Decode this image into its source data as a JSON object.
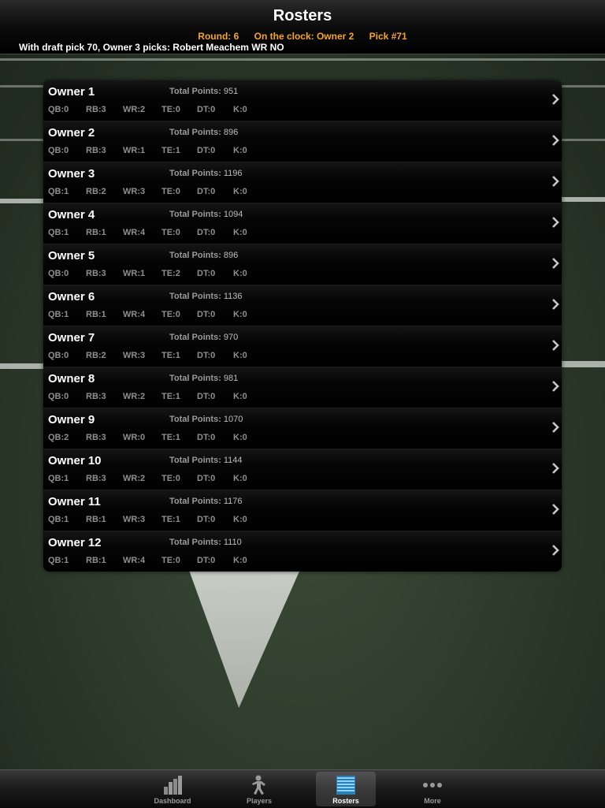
{
  "header": {
    "title": "Rosters",
    "round": "Round: 6",
    "on_clock": "On the clock: Owner 2",
    "pick": "Pick #71",
    "ticker": "With draft pick 70, Owner 3 picks: Robert Meachem WR NO"
  },
  "points_label": "Total Points:",
  "rosters": [
    {
      "owner": "Owner 1",
      "points": "951",
      "qb": "QB:0",
      "rb": "RB:3",
      "wr": "WR:2",
      "te": "TE:0",
      "dt": "DT:0",
      "k": "K:0"
    },
    {
      "owner": "Owner 2",
      "points": "896",
      "qb": "QB:0",
      "rb": "RB:3",
      "wr": "WR:1",
      "te": "TE:1",
      "dt": "DT:0",
      "k": "K:0"
    },
    {
      "owner": "Owner 3",
      "points": "1196",
      "qb": "QB:1",
      "rb": "RB:2",
      "wr": "WR:3",
      "te": "TE:0",
      "dt": "DT:0",
      "k": "K:0"
    },
    {
      "owner": "Owner 4",
      "points": "1094",
      "qb": "QB:1",
      "rb": "RB:1",
      "wr": "WR:4",
      "te": "TE:0",
      "dt": "DT:0",
      "k": "K:0"
    },
    {
      "owner": "Owner 5",
      "points": "896",
      "qb": "QB:0",
      "rb": "RB:3",
      "wr": "WR:1",
      "te": "TE:2",
      "dt": "DT:0",
      "k": "K:0"
    },
    {
      "owner": "Owner 6",
      "points": "1136",
      "qb": "QB:1",
      "rb": "RB:1",
      "wr": "WR:4",
      "te": "TE:0",
      "dt": "DT:0",
      "k": "K:0"
    },
    {
      "owner": "Owner 7",
      "points": "970",
      "qb": "QB:0",
      "rb": "RB:2",
      "wr": "WR:3",
      "te": "TE:1",
      "dt": "DT:0",
      "k": "K:0"
    },
    {
      "owner": "Owner 8",
      "points": "981",
      "qb": "QB:0",
      "rb": "RB:3",
      "wr": "WR:2",
      "te": "TE:1",
      "dt": "DT:0",
      "k": "K:0"
    },
    {
      "owner": "Owner 9",
      "points": "1070",
      "qb": "QB:2",
      "rb": "RB:3",
      "wr": "WR:0",
      "te": "TE:1",
      "dt": "DT:0",
      "k": "K:0"
    },
    {
      "owner": "Owner 10",
      "points": "1144",
      "qb": "QB:1",
      "rb": "RB:3",
      "wr": "WR:2",
      "te": "TE:0",
      "dt": "DT:0",
      "k": "K:0"
    },
    {
      "owner": "Owner 11",
      "points": "1176",
      "qb": "QB:1",
      "rb": "RB:1",
      "wr": "WR:3",
      "te": "TE:1",
      "dt": "DT:0",
      "k": "K:0"
    },
    {
      "owner": "Owner 12",
      "points": "1110",
      "qb": "QB:1",
      "rb": "RB:1",
      "wr": "WR:4",
      "te": "TE:0",
      "dt": "DT:0",
      "k": "K:0"
    }
  ],
  "tabs": [
    {
      "label": "Dashboard",
      "icon": "bar-chart-icon",
      "active": false
    },
    {
      "label": "Players",
      "icon": "football-player-icon",
      "active": false
    },
    {
      "label": "Rosters",
      "icon": "list-icon",
      "active": true
    },
    {
      "label": "More",
      "icon": "more-dots-icon",
      "active": false
    }
  ],
  "colors": {
    "accent": "#f5a623",
    "active_tab": "#4fb3e8"
  }
}
